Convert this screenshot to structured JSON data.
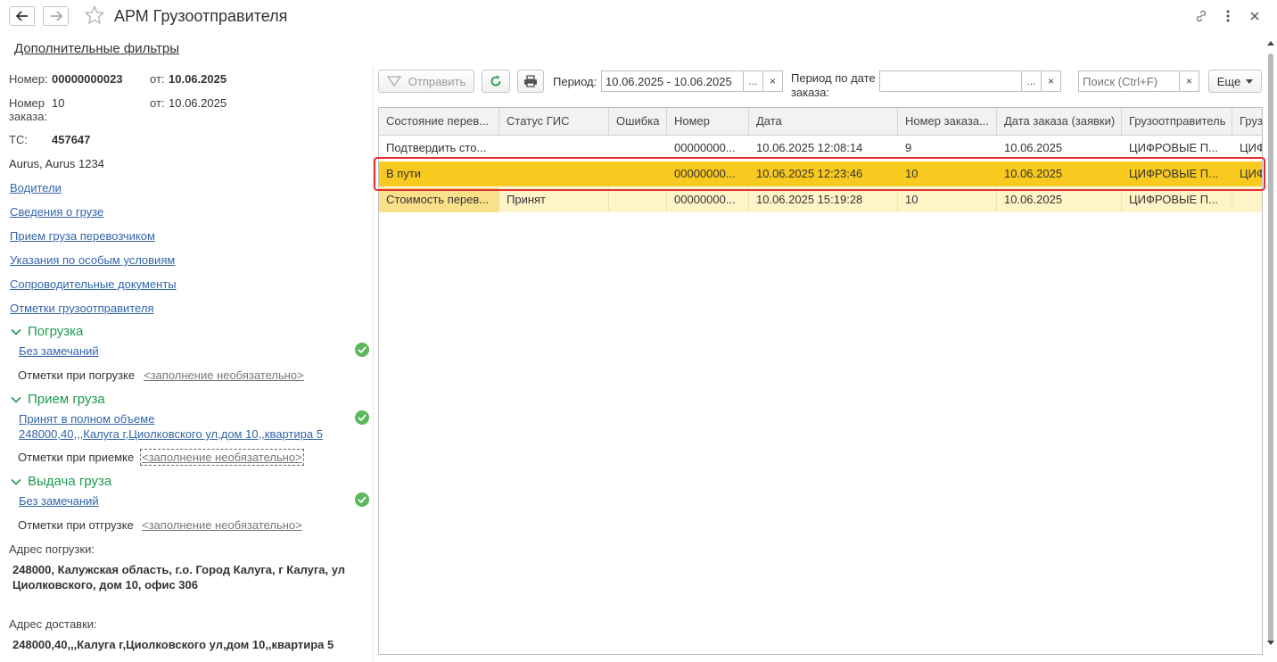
{
  "window": {
    "title": "АРМ Грузоотправителя"
  },
  "filters_link": "Дополнительные фильтры",
  "left": {
    "number_label": "Номер:",
    "number_value": "00000000023",
    "from_label": "от:",
    "from_value": "10.06.2025",
    "order_label": "Номер заказа:",
    "order_label_1": "Номер",
    "order_label_2": "заказа:",
    "order_value": "10",
    "order_from_label": "от:",
    "order_from_value": "10.06.2025",
    "ts_label": "ТС:",
    "ts_value": "457647",
    "vehicle": "Aurus, Aurus 1234",
    "links": [
      "Водители",
      "Сведения о грузе",
      "Прием груза перевозчиком",
      "Указания по особым условиям",
      "Сопроводительные документы",
      "Отметки грузоотправителя"
    ],
    "loading": {
      "title": "Погрузка",
      "status": "Без замечаний",
      "marks_label": "Отметки при погрузке",
      "marks_value": "<заполнение необязательно>"
    },
    "receipt": {
      "title": "Прием груза",
      "status": "Принят в полном объеме",
      "address": "248000,40,,,Калуга г,Циолковского ул,дом 10,,квартира 5",
      "marks_label": "Отметки при приемке",
      "marks_value": "<заполнение необязательно>"
    },
    "delivery": {
      "title": "Выдача груза",
      "status": "Без замечаний",
      "marks_label": "Отметки при отгрузке",
      "marks_value": "<заполнение необязательно>"
    },
    "load_address_label": "Адрес погрузки:",
    "load_address_1": "248000, Калужская область, г.о. Город Калуга, г Калуга, ул",
    "load_address_2": "Циолковского, дом 10, офис 306",
    "delivery_address_label": "Адрес доставки:",
    "delivery_address": "248000,40,,,Калуга г,Циолковского ул,дом 10,,квартира 5"
  },
  "toolbar": {
    "send_label": "Отправить",
    "period_label": "Период:",
    "period_value": "10.06.2025 - 10.06.2025",
    "period_order_label_1": "Период по дате",
    "period_order_label_2": "заказа:",
    "period_order_value": "",
    "search_placeholder": "Поиск (Ctrl+F)",
    "more_label": "Еще",
    "ellipsis": "...",
    "clear": "×"
  },
  "table": {
    "columns": [
      "Состояние перев...",
      "Статус ГИС",
      "Ошибка",
      "Номер",
      "Дата",
      "Номер заказа...",
      "Дата заказа (заявки)",
      "Грузоотправитель",
      "Груз"
    ],
    "rows": [
      [
        "Подтвердить сто...",
        "",
        "",
        "00000000...",
        "10.06.2025 12:08:14",
        "9",
        "10.06.2025",
        "ЦИФРОВЫЕ П...",
        "ЦИФ"
      ],
      [
        "В пути",
        "",
        "",
        "00000000...",
        "10.06.2025 12:23:46",
        "10",
        "10.06.2025",
        "ЦИФРОВЫЕ П...",
        "ЦИФ"
      ],
      [
        "Стоимость перев...",
        "Принят",
        "",
        "00000000...",
        "10.06.2025 15:19:28",
        "10",
        "10.06.2025",
        "ЦИФРОВЫЕ П...",
        ""
      ]
    ]
  },
  "colors": {
    "accent_green": "#1e9a52",
    "selected_row": "#f8c91e",
    "highlight_border": "#e03030",
    "link": "#3366aa"
  }
}
